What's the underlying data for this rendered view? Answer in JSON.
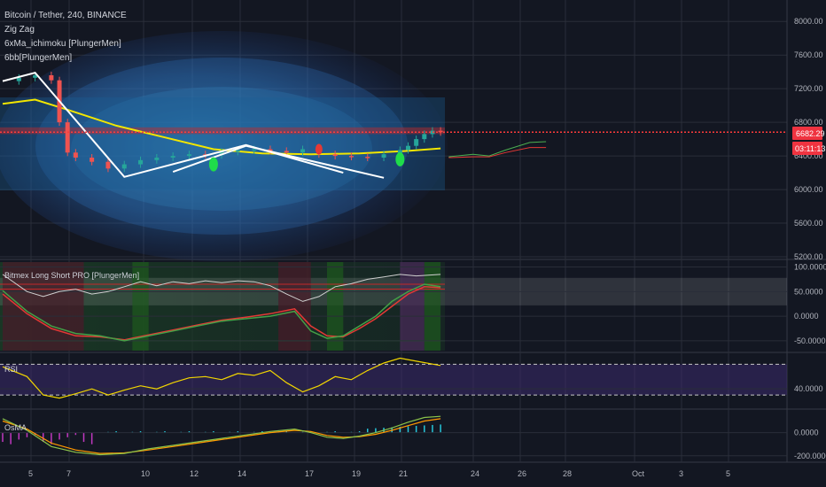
{
  "colors": {
    "background": "#131722",
    "grid": "#2a2e39",
    "up": "#26a69a",
    "down": "#ef5350",
    "price_line": "#ff3b3b",
    "axis_text": "#b2b5be",
    "legend_text": "#d1d4dc"
  },
  "chart_data": {
    "type": "candlestick",
    "title": "Bitcoin / Tether, 240, BINANCE",
    "legend": [
      "Zig Zag",
      "6xMa_ichimoku [PlungerMen]",
      "6bb[PlungerMen]"
    ],
    "x_ticks": [
      "5",
      "7",
      "10",
      "12",
      "14",
      "17",
      "19",
      "21",
      "24",
      "26",
      "28",
      "Oct",
      "3",
      "5"
    ],
    "y_axis": {
      "ticks": [
        "8000.00",
        "7600.00",
        "7200.00",
        "6800.00",
        "6400.00",
        "6000.00",
        "5600.00",
        "5200.00"
      ],
      "ylim": [
        5200,
        8150
      ]
    },
    "price_tag": "6682.29",
    "countdown_tag": "03:11:13",
    "last_price": 6682.29,
    "price_path": [
      [
        0,
        7290
      ],
      [
        2,
        7330
      ],
      [
        4,
        7360
      ],
      [
        6,
        7300
      ],
      [
        7,
        6800
      ],
      [
        8,
        6440
      ],
      [
        9,
        6380
      ],
      [
        11,
        6330
      ],
      [
        13,
        6250
      ],
      [
        15,
        6300
      ],
      [
        17,
        6350
      ],
      [
        19,
        6380
      ],
      [
        21,
        6400
      ],
      [
        23,
        6420
      ],
      [
        25,
        6410
      ],
      [
        27,
        6450
      ],
      [
        29,
        6470
      ],
      [
        31,
        6480
      ],
      [
        33,
        6460
      ],
      [
        35,
        6440
      ],
      [
        37,
        6480
      ],
      [
        39,
        6420
      ],
      [
        41,
        6400
      ],
      [
        43,
        6390
      ],
      [
        45,
        6380
      ],
      [
        47,
        6420
      ],
      [
        49,
        6470
      ],
      [
        50,
        6520
      ],
      [
        51,
        6600
      ],
      [
        52,
        6660
      ],
      [
        53,
        6700
      ],
      [
        54,
        6682
      ]
    ],
    "zigzag": [
      [
        0,
        7290
      ],
      [
        4,
        7390
      ],
      [
        15,
        6150
      ],
      [
        30,
        6530
      ],
      [
        42,
        6200
      ]
    ],
    "zigzag_overlay": [
      [
        21,
        6210
      ],
      [
        30,
        6520
      ],
      [
        47,
        6140
      ]
    ],
    "panels": [
      {
        "name": "Bitmex Long Short PRO [PlungerMen]",
        "y_ticks": [
          "100.0000",
          "50.0000",
          "0.0000",
          "-50.0000"
        ],
        "ylim": [
          -70,
          110
        ],
        "white_line": [
          [
            0,
            85
          ],
          [
            3,
            50
          ],
          [
            5,
            40
          ],
          [
            7,
            50
          ],
          [
            9,
            55
          ],
          [
            11,
            45
          ],
          [
            13,
            50
          ],
          [
            15,
            60
          ],
          [
            17,
            70
          ],
          [
            19,
            62
          ],
          [
            21,
            70
          ],
          [
            23,
            66
          ],
          [
            25,
            72
          ],
          [
            27,
            68
          ],
          [
            29,
            72
          ],
          [
            31,
            70
          ],
          [
            33,
            62
          ],
          [
            35,
            45
          ],
          [
            37,
            30
          ],
          [
            39,
            40
          ],
          [
            41,
            60
          ],
          [
            43,
            66
          ],
          [
            45,
            75
          ],
          [
            47,
            80
          ],
          [
            49,
            85
          ],
          [
            51,
            82
          ],
          [
            54,
            85
          ]
        ],
        "green_line": [
          [
            0,
            52
          ],
          [
            3,
            10
          ],
          [
            6,
            -20
          ],
          [
            9,
            -35
          ],
          [
            12,
            -40
          ],
          [
            15,
            -50
          ],
          [
            18,
            -40
          ],
          [
            21,
            -30
          ],
          [
            24,
            -20
          ],
          [
            27,
            -10
          ],
          [
            30,
            -5
          ],
          [
            33,
            0
          ],
          [
            36,
            10
          ],
          [
            38,
            -30
          ],
          [
            40,
            -45
          ],
          [
            42,
            -40
          ],
          [
            44,
            -20
          ],
          [
            46,
            0
          ],
          [
            48,
            30
          ],
          [
            50,
            50
          ],
          [
            52,
            65
          ],
          [
            54,
            60
          ]
        ],
        "red_line": [
          [
            0,
            45
          ],
          [
            3,
            5
          ],
          [
            6,
            -25
          ],
          [
            9,
            -40
          ],
          [
            12,
            -42
          ],
          [
            15,
            -48
          ],
          [
            18,
            -38
          ],
          [
            21,
            -28
          ],
          [
            24,
            -18
          ],
          [
            27,
            -8
          ],
          [
            30,
            -2
          ],
          [
            33,
            5
          ],
          [
            36,
            15
          ],
          [
            38,
            -20
          ],
          [
            40,
            -40
          ],
          [
            42,
            -42
          ],
          [
            44,
            -25
          ],
          [
            46,
            -5
          ],
          [
            48,
            20
          ],
          [
            50,
            45
          ],
          [
            52,
            60
          ],
          [
            54,
            58
          ]
        ]
      },
      {
        "name": "RSI",
        "y_ticks": [
          "40.0000"
        ],
        "ylim": [
          10,
          95
        ],
        "values": [
          [
            0,
            76
          ],
          [
            3,
            60
          ],
          [
            5,
            30
          ],
          [
            7,
            25
          ],
          [
            9,
            32
          ],
          [
            11,
            40
          ],
          [
            13,
            30
          ],
          [
            15,
            38
          ],
          [
            17,
            45
          ],
          [
            19,
            40
          ],
          [
            21,
            50
          ],
          [
            23,
            58
          ],
          [
            25,
            60
          ],
          [
            27,
            55
          ],
          [
            29,
            65
          ],
          [
            31,
            62
          ],
          [
            33,
            70
          ],
          [
            35,
            50
          ],
          [
            37,
            35
          ],
          [
            39,
            45
          ],
          [
            41,
            60
          ],
          [
            43,
            55
          ],
          [
            45,
            70
          ],
          [
            47,
            82
          ],
          [
            49,
            90
          ],
          [
            51,
            85
          ],
          [
            54,
            78
          ]
        ]
      },
      {
        "name": "OsMA",
        "y_ticks": [
          "0.0000",
          "-200.0000"
        ],
        "ylim": [
          -240,
          180
        ],
        "green_line": [
          [
            0,
            120
          ],
          [
            3,
            20
          ],
          [
            6,
            -120
          ],
          [
            9,
            -170
          ],
          [
            12,
            -190
          ],
          [
            15,
            -180
          ],
          [
            18,
            -140
          ],
          [
            21,
            -110
          ],
          [
            24,
            -80
          ],
          [
            27,
            -50
          ],
          [
            30,
            -20
          ],
          [
            33,
            10
          ],
          [
            36,
            30
          ],
          [
            38,
            0
          ],
          [
            40,
            -40
          ],
          [
            42,
            -50
          ],
          [
            44,
            -30
          ],
          [
            46,
            0
          ],
          [
            48,
            40
          ],
          [
            50,
            90
          ],
          [
            52,
            130
          ],
          [
            54,
            140
          ]
        ],
        "orange_line": [
          [
            0,
            100
          ],
          [
            3,
            30
          ],
          [
            6,
            -90
          ],
          [
            9,
            -150
          ],
          [
            12,
            -180
          ],
          [
            15,
            -175
          ],
          [
            18,
            -150
          ],
          [
            21,
            -120
          ],
          [
            24,
            -90
          ],
          [
            27,
            -60
          ],
          [
            30,
            -30
          ],
          [
            33,
            0
          ],
          [
            36,
            20
          ],
          [
            38,
            10
          ],
          [
            40,
            -25
          ],
          [
            42,
            -40
          ],
          [
            44,
            -35
          ],
          [
            46,
            -15
          ],
          [
            48,
            20
          ],
          [
            50,
            60
          ],
          [
            52,
            100
          ],
          [
            54,
            120
          ]
        ]
      }
    ]
  }
}
